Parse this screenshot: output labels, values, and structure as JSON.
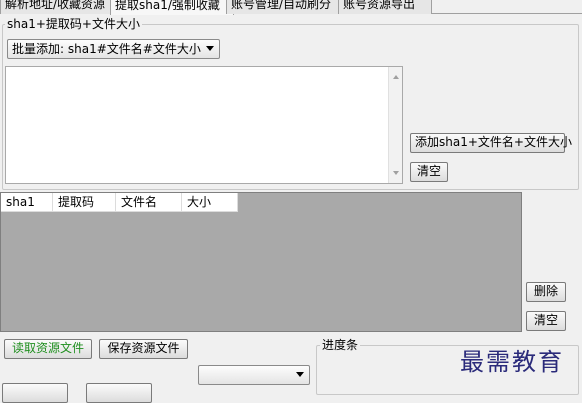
{
  "tabs": [
    {
      "label": "解析地址/收藏资源"
    },
    {
      "label": "提取sha1/强制收藏"
    },
    {
      "label": "账号管理/自动刷分"
    },
    {
      "label": "账号资源导出"
    }
  ],
  "group_sha1": {
    "legend": "sha1+提取码+文件大小",
    "batch_combo_value": "批量添加: sha1#文件名#文件大小",
    "textarea_value": "",
    "add_button": "添加sha1+文件名+文件大小",
    "clear_button": "清空"
  },
  "list": {
    "columns": [
      "sha1",
      "提取码",
      "文件名",
      "大小"
    ],
    "rows": [],
    "delete_button": "删除",
    "clear_button": "清空"
  },
  "bottom": {
    "read_button": "读取资源文件",
    "save_button": "保存资源文件",
    "combo_value": "",
    "progress_legend": "进度条"
  },
  "watermark": "最需教育",
  "colors": {
    "window_bg": "#f0f0f0",
    "list_bg": "#a9a9a9",
    "read_button_text": "#1f8f1f"
  }
}
